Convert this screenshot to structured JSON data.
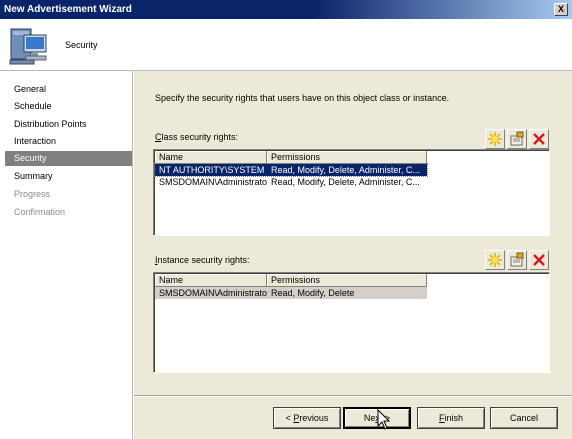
{
  "window": {
    "title": "New Advertisement Wizard",
    "close_glyph": "X"
  },
  "header": {
    "icon": "computer-icon",
    "page_title": "Security"
  },
  "sidebar": {
    "items": [
      {
        "label": "General",
        "state": "normal"
      },
      {
        "label": "Schedule",
        "state": "normal"
      },
      {
        "label": "Distribution Points",
        "state": "normal"
      },
      {
        "label": "Interaction",
        "state": "normal"
      },
      {
        "label": "Security",
        "state": "selected"
      },
      {
        "label": "Summary",
        "state": "normal"
      },
      {
        "label": "Progress",
        "state": "disabled"
      },
      {
        "label": "Confirmation",
        "state": "disabled"
      }
    ]
  },
  "main": {
    "description": "Specify the security rights that users have on this object class or instance.",
    "class_rights": {
      "label_prefix": "",
      "label_underlined": "C",
      "label_rest": "lass security rights:",
      "columns": [
        "Name",
        "Permissions"
      ],
      "rows": [
        {
          "name": "NT AUTHORITY\\SYSTEM",
          "permissions": "Read, Modify, Delete, Administer, C...",
          "selected": true
        },
        {
          "name": "SMSDOMAIN\\Administrator",
          "permissions": "Read, Modify, Delete, Administer, C...",
          "selected": false
        }
      ]
    },
    "instance_rights": {
      "label_prefix": "",
      "label_underlined": "I",
      "label_rest": "nstance security rights:",
      "columns": [
        "Name",
        "Permissions"
      ],
      "rows": [
        {
          "name": "SMSDOMAIN\\Administrator",
          "permissions": "Read, Modify, Delete",
          "selected": true
        }
      ]
    },
    "toolbar_icons": [
      "new-icon",
      "properties-icon",
      "delete-icon"
    ]
  },
  "buttons": {
    "previous_prefix": "< ",
    "previous_underlined": "P",
    "previous_rest": "revious",
    "next_prefix": "Ne",
    "next_underlined": "x",
    "next_rest": "t >",
    "finish_underlined": "F",
    "finish_rest": "inish",
    "cancel": "Cancel"
  },
  "colors": {
    "titlebar": "#0a246a",
    "selection": "#0a246a",
    "sidebar_selected": "#808080",
    "dialog_face": "#ece9d8"
  }
}
